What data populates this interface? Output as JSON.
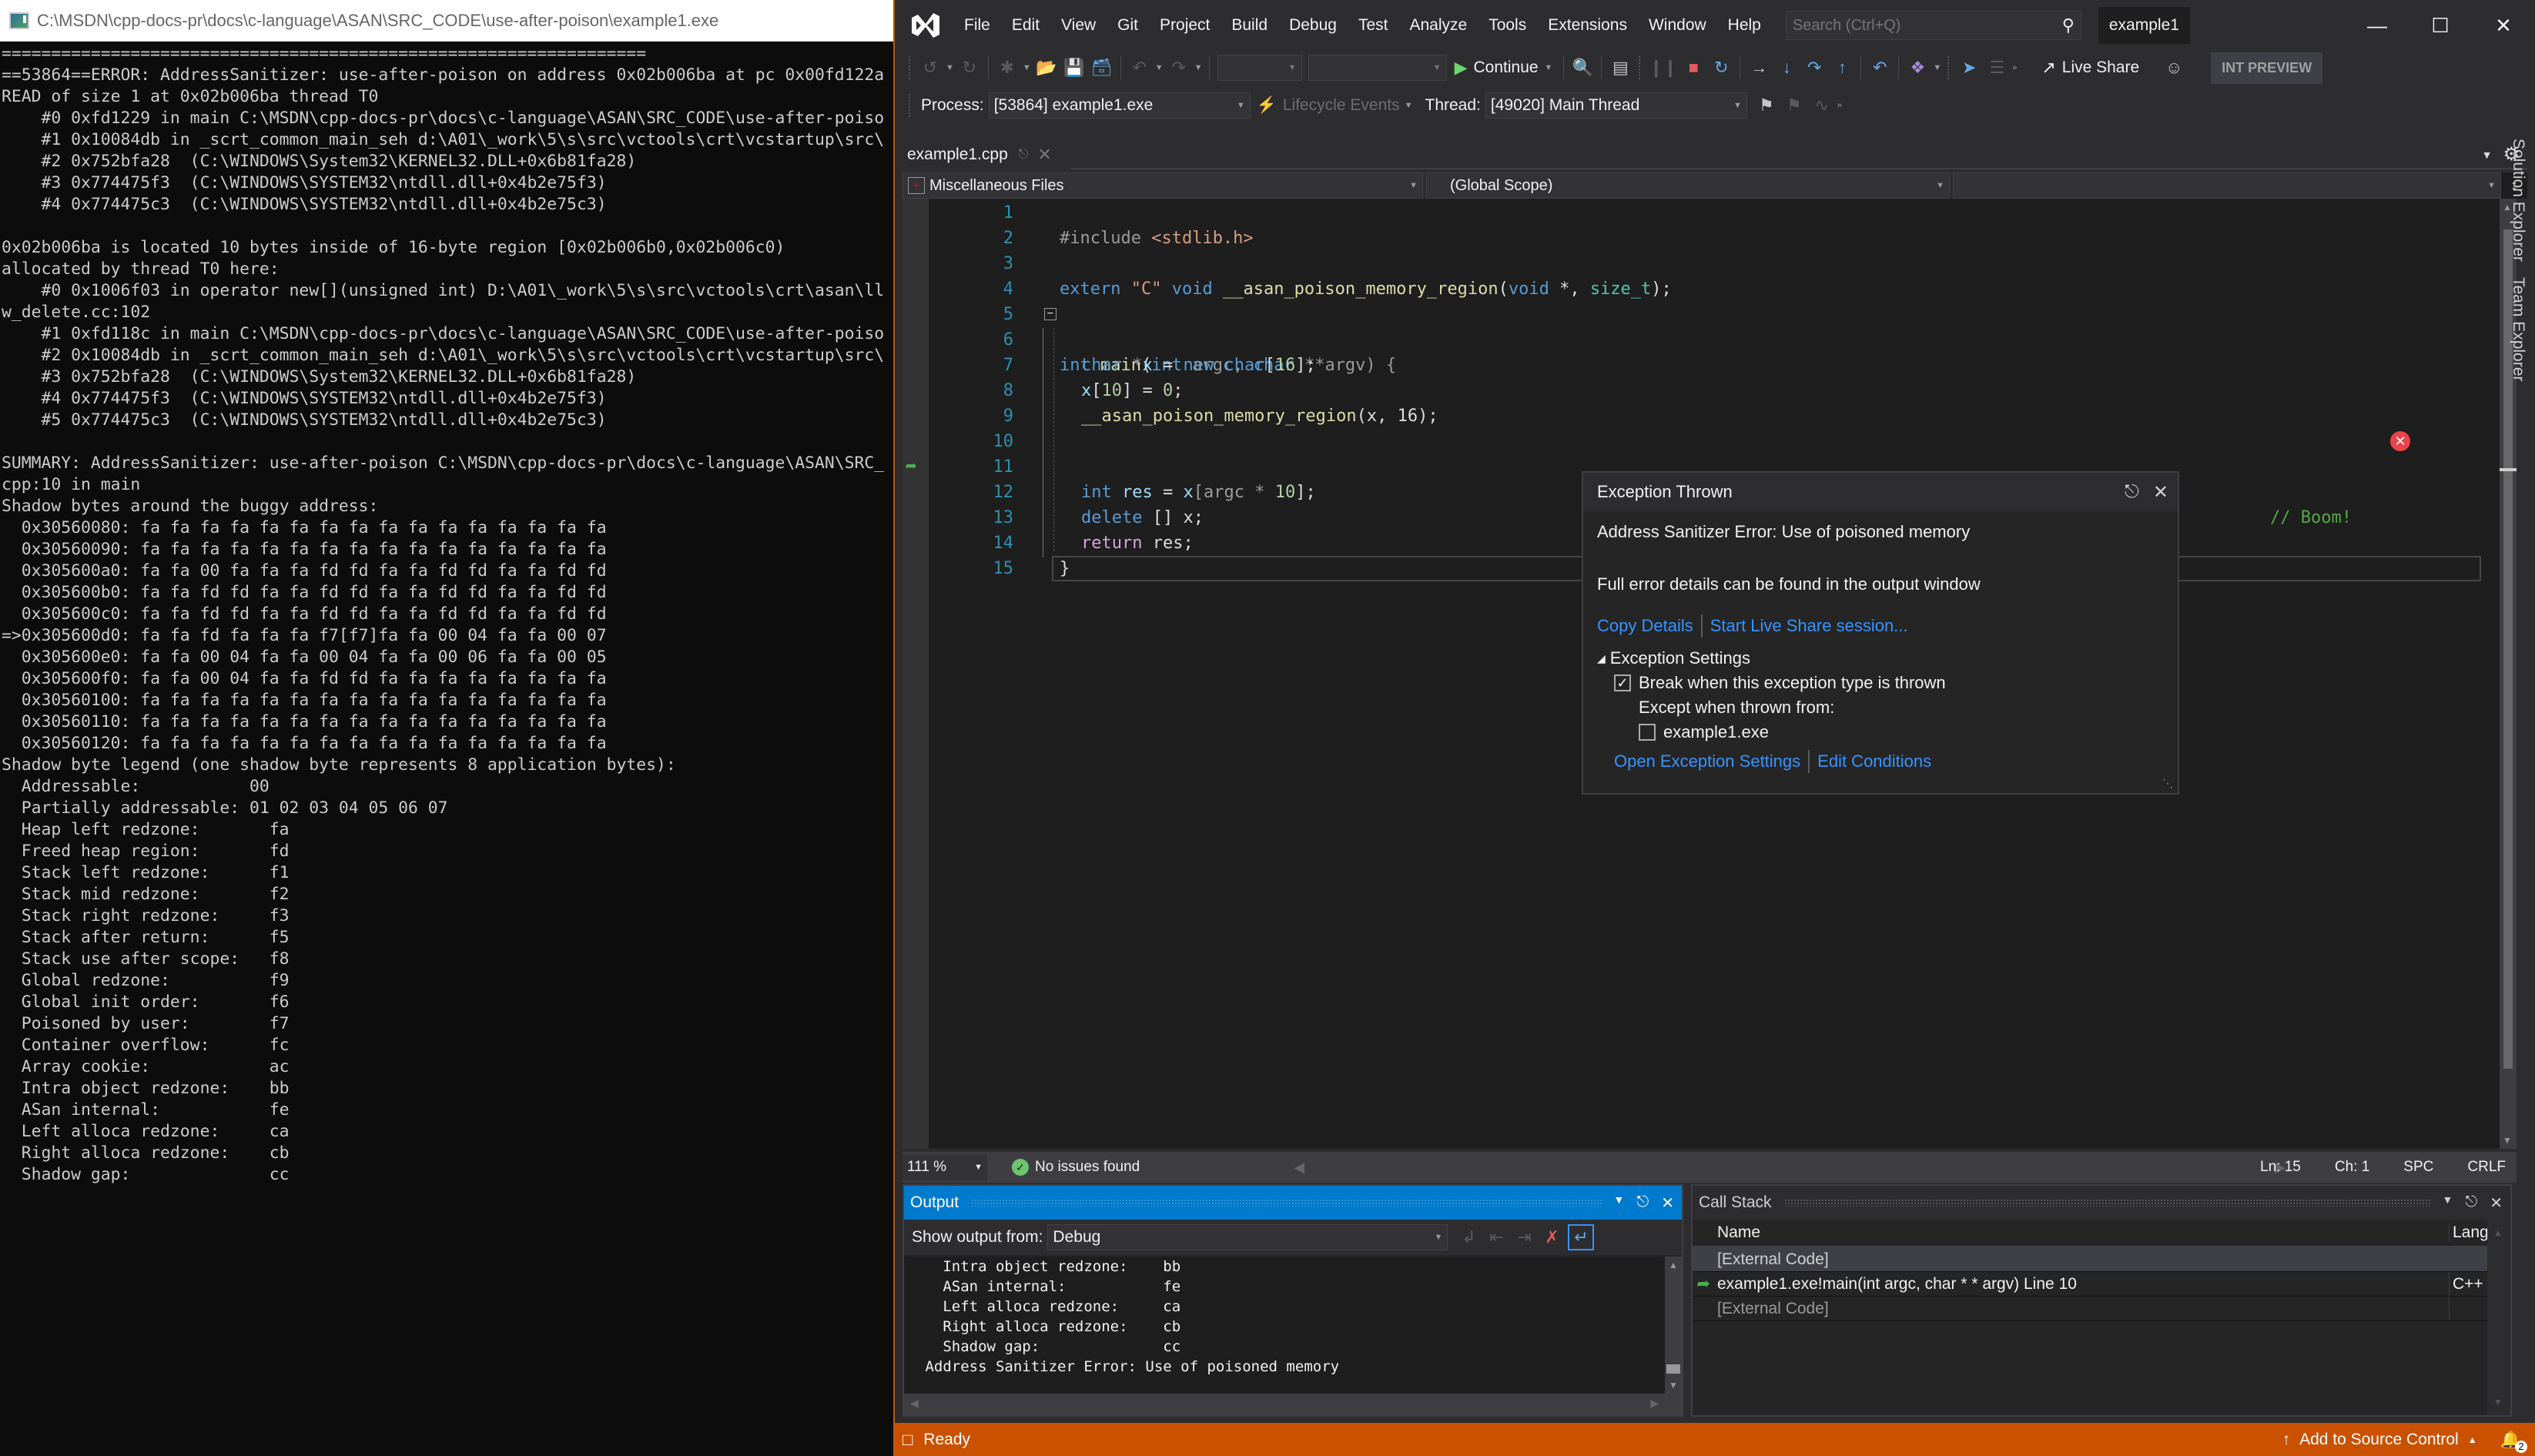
{
  "console": {
    "title": "C:\\MSDN\\cpp-docs-pr\\docs\\c-language\\ASAN\\SRC_CODE\\use-after-poison\\example1.exe",
    "lines": [
      "=================================================================",
      "==53864==ERROR: AddressSanitizer: use-after-poison on address 0x02b006ba at pc 0x00fd122a",
      "READ of size 1 at 0x02b006ba thread T0",
      "    #0 0xfd1229 in main C:\\MSDN\\cpp-docs-pr\\docs\\c-language\\ASAN\\SRC_CODE\\use-after-poiso",
      "    #1 0x10084db in _scrt_common_main_seh d:\\A01\\_work\\5\\s\\src\\vctools\\crt\\vcstartup\\src\\",
      "    #2 0x752bfa28  (C:\\WINDOWS\\System32\\KERNEL32.DLL+0x6b81fa28)",
      "    #3 0x774475f3  (C:\\WINDOWS\\SYSTEM32\\ntdll.dll+0x4b2e75f3)",
      "    #4 0x774475c3  (C:\\WINDOWS\\SYSTEM32\\ntdll.dll+0x4b2e75c3)",
      "",
      "0x02b006ba is located 10 bytes inside of 16-byte region [0x02b006b0,0x02b006c0)",
      "allocated by thread T0 here:",
      "    #0 0x1006f03 in operator new[](unsigned int) D:\\A01\\_work\\5\\s\\src\\vctools\\crt\\asan\\ll",
      "w_delete.cc:102",
      "    #1 0xfd118c in main C:\\MSDN\\cpp-docs-pr\\docs\\c-language\\ASAN\\SRC_CODE\\use-after-poiso",
      "    #2 0x10084db in _scrt_common_main_seh d:\\A01\\_work\\5\\s\\src\\vctools\\crt\\vcstartup\\src\\",
      "    #3 0x752bfa28  (C:\\WINDOWS\\System32\\KERNEL32.DLL+0x6b81fa28)",
      "    #4 0x774475f3  (C:\\WINDOWS\\SYSTEM32\\ntdll.dll+0x4b2e75f3)",
      "    #5 0x774475c3  (C:\\WINDOWS\\SYSTEM32\\ntdll.dll+0x4b2e75c3)",
      "",
      "SUMMARY: AddressSanitizer: use-after-poison C:\\MSDN\\cpp-docs-pr\\docs\\c-language\\ASAN\\SRC_",
      "cpp:10 in main",
      "Shadow bytes around the buggy address:",
      "  0x30560080: fa fa fa fa fa fa fa fa fa fa fa fa fa fa fa fa",
      "  0x30560090: fa fa fa fa fa fa fa fa fa fa fa fa fa fa fa fa",
      "  0x305600a0: fa fa 00 fa fa fa fd fd fa fa fd fd fa fa fd fd",
      "  0x305600b0: fa fa fd fd fa fa fd fd fa fa fd fd fa fa fd fd",
      "  0x305600c0: fa fa fd fd fa fa fd fd fa fa fd fd fa fa fd fd",
      "=>0x305600d0: fa fa fd fa fa fa f7[f7]fa fa 00 04 fa fa 00 07",
      "  0x305600e0: fa fa 00 04 fa fa 00 04 fa fa 00 06 fa fa 00 05",
      "  0x305600f0: fa fa 00 04 fa fa fd fd fa fa fa fa fa fa fa fa",
      "  0x30560100: fa fa fa fa fa fa fa fa fa fa fa fa fa fa fa fa",
      "  0x30560110: fa fa fa fa fa fa fa fa fa fa fa fa fa fa fa fa",
      "  0x30560120: fa fa fa fa fa fa fa fa fa fa fa fa fa fa fa fa",
      "Shadow byte legend (one shadow byte represents 8 application bytes):",
      "  Addressable:           00",
      "  Partially addressable: 01 02 03 04 05 06 07",
      "  Heap left redzone:       fa",
      "  Freed heap region:       fd",
      "  Stack left redzone:      f1",
      "  Stack mid redzone:       f2",
      "  Stack right redzone:     f3",
      "  Stack after return:      f5",
      "  Stack use after scope:   f8",
      "  Global redzone:          f9",
      "  Global init order:       f6",
      "  Poisoned by user:        f7",
      "  Container overflow:      fc",
      "  Array cookie:            ac",
      "  Intra object redzone:    bb",
      "  ASan internal:           fe",
      "  Left alloca redzone:     ca",
      "  Right alloca redzone:    cb",
      "  Shadow gap:              cc"
    ]
  },
  "vs": {
    "menu": [
      "File",
      "Edit",
      "View",
      "Git",
      "Project",
      "Build",
      "Debug",
      "Test",
      "Analyze",
      "Tools",
      "Extensions",
      "Window",
      "Help"
    ],
    "search_placeholder": "Search (Ctrl+Q)",
    "solution_name": "example1",
    "toolbar": {
      "continue_label": "Continue",
      "live_share_label": "Live Share",
      "int_preview_label": "INT PREVIEW"
    },
    "debug_location": {
      "process_label": "Process:",
      "process_value": "[53864] example1.exe",
      "lifecycle_label": "Lifecycle Events",
      "thread_label": "Thread:",
      "thread_value": "[49020] Main Thread"
    },
    "doc_tab": "example1.cpp",
    "nav": {
      "project": "Miscellaneous Files",
      "scope": "(Global Scope)",
      "member": ""
    },
    "code_lines": [
      {
        "no": "1"
      },
      {
        "no": "2"
      },
      {
        "no": "3"
      },
      {
        "no": "4"
      },
      {
        "no": "5"
      },
      {
        "no": "6"
      },
      {
        "no": "7"
      },
      {
        "no": "8"
      },
      {
        "no": "9"
      },
      {
        "no": "10"
      },
      {
        "no": "11"
      },
      {
        "no": "12"
      },
      {
        "no": "13"
      },
      {
        "no": "14"
      },
      {
        "no": "15"
      }
    ],
    "code": {
      "l1_directive": "#include",
      "l1_header": "<stdlib.h>",
      "l3_extern": "extern",
      "l3_str": "\"C\"",
      "l3_void": "void",
      "l3_fn": "__asan_poison_memory_region",
      "l3_open": "(",
      "l3_void2": "void",
      "l3_star": " *, ",
      "l3_type": "size_t",
      "l3_close": ");",
      "l5_int": "int",
      "l5_main": "main",
      "l5_open": "(",
      "l5_int2": "int",
      "l5_argc": "argc,",
      "l5_char": "char",
      "l5_argv": "**argv) {",
      "l6_char": "char",
      "l6_star": "*",
      "l6_x": "x",
      "l6_eq": " = ",
      "l6_new": "new",
      "l6_char2": "char",
      "l6_br": "[",
      "l6_num": "16",
      "l6_end": "];",
      "l7_x": "x",
      "l7_br": "[",
      "l7_num": "10",
      "l7_eq": "] = ",
      "l7_zero": "0",
      "l7_end": ";",
      "l8_fn": "__asan_poison_memory_region",
      "l8_args": "(x, 16);",
      "l10_int": "int",
      "l10_res": "res",
      "l10_eq": " = ",
      "l10_x": "x",
      "l10_idx": "[argc * ",
      "l10_num": "10",
      "l10_end": "];",
      "l10_comment": "// Boom!",
      "l12_delete": "delete",
      "l12_rest": " [] x;",
      "l13_return": "return",
      "l13_rest": " res;",
      "l14_brace": "}"
    },
    "exception": {
      "title": "Exception Thrown",
      "message": "Address Sanitizer Error: Use of poisoned memory",
      "details": "Full error details can be found in the output window",
      "copy_details": "Copy Details",
      "live_share": "Start Live Share session...",
      "settings_header": "Exception Settings",
      "break_label": "Break when this exception type is thrown",
      "break_checked": true,
      "except_label": "Except when thrown from:",
      "except_module": "example1.exe",
      "except_checked": false,
      "open_settings": "Open Exception Settings",
      "edit_conditions": "Edit Conditions"
    },
    "editor_status": {
      "zoom": "111 %",
      "issues": "No issues found",
      "line": "Ln: 15",
      "col": "Ch: 1",
      "whitespace": "SPC",
      "eol": "CRLF"
    },
    "output": {
      "title": "Output",
      "show_from_label": "Show output from:",
      "source": "Debug",
      "lines": [
        "   Intra object redzone:    bb",
        "   ASan internal:           fe",
        "   Left alloca redzone:     ca",
        "   Right alloca redzone:    cb",
        "   Shadow gap:              cc",
        " Address Sanitizer Error: Use of poisoned memory"
      ]
    },
    "call_stack": {
      "title": "Call Stack",
      "col_name": "Name",
      "col_lang": "Lang",
      "rows": [
        {
          "name": "[External Code]",
          "lang": "",
          "current": false
        },
        {
          "name": "example1.exe!main(int argc, char * * argv) Line 10",
          "lang": "C++",
          "current": true
        },
        {
          "name": "[External Code]",
          "lang": "",
          "current": false
        }
      ]
    },
    "side_tabs": [
      "Solution Explorer",
      "Team Explorer"
    ],
    "status": {
      "ready": "Ready",
      "source_control": "Add to Source Control",
      "notifications": "2"
    },
    "colors": {
      "status_bar": "#ca5100",
      "accent": "#007acc",
      "link": "#3794ff",
      "error": "#e8444a"
    }
  }
}
